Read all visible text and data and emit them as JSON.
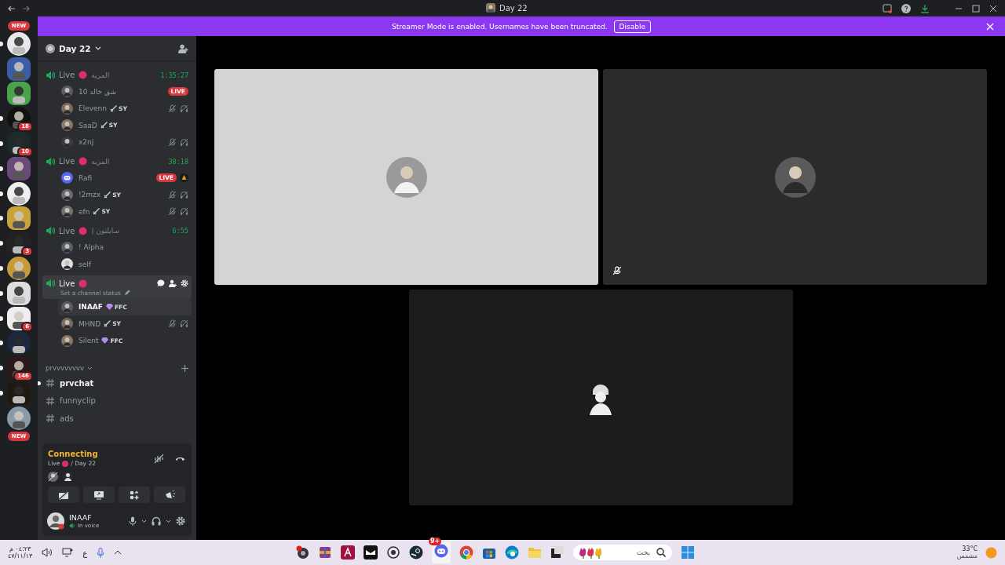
{
  "window": {
    "title": "Day 22"
  },
  "banner": {
    "text": "Streamer Mode is enabled. Usernames have been truncated.",
    "button": "Disable"
  },
  "servers": {
    "top_badge": "NEW",
    "bottom_badge": "NEW",
    "items": [
      {
        "unread": true
      },
      {
        "unread": false
      },
      {
        "unread": false
      },
      {
        "unread": true,
        "badge": "18"
      },
      {
        "unread": true,
        "badge": "10"
      },
      {
        "unread": true
      },
      {
        "unread": true
      },
      {
        "unread": true
      },
      {
        "unread": true,
        "badge": "3"
      },
      {
        "unread": true
      },
      {
        "unread": true
      },
      {
        "unread": true,
        "badge": "6"
      },
      {
        "unread": true
      },
      {
        "unread": true,
        "badge": "146"
      },
      {
        "unread": true
      },
      {
        "unread": false
      }
    ]
  },
  "guild": {
    "name": "Day 22"
  },
  "voice_channels": [
    {
      "name": "Live",
      "status": "المزيه",
      "timer": "1:35:27",
      "selected": false,
      "users": [
        {
          "name": "شق خالد 10",
          "badge": "LIVE",
          "muted": false
        },
        {
          "name": "Elevenn",
          "tag": {
            "kind": "sword",
            "text": "SY"
          },
          "muted": true
        },
        {
          "name": "SaaD",
          "tag": {
            "kind": "sword",
            "text": "SY"
          },
          "muted": false
        },
        {
          "name": "x2nj",
          "muted": true
        }
      ]
    },
    {
      "name": "Live",
      "status": "المزيه",
      "timer": "38:18",
      "selected": false,
      "users": [
        {
          "name": "Rafi",
          "badge": "LIVE",
          "muted": false,
          "activity": true
        },
        {
          "name": "!2mzx",
          "tag": {
            "kind": "sword",
            "text": "SY"
          },
          "muted": true
        },
        {
          "name": "efn",
          "tag": {
            "kind": "sword",
            "text": "SY"
          },
          "muted": true
        }
      ]
    },
    {
      "name": "Live",
      "status": "| سايلتون",
      "timer": "6:55",
      "selected": false,
      "users": [
        {
          "name": "! Alpha",
          "muted": false
        },
        {
          "name": "self",
          "muted": false
        }
      ]
    },
    {
      "name": "Live",
      "subtitle": "Set a channel status",
      "selected": true,
      "users": [
        {
          "name": "INAAF",
          "tag": {
            "kind": "gem",
            "text": "FFC"
          },
          "muted": false,
          "hovered": true
        },
        {
          "name": "MHND",
          "tag": {
            "kind": "sword",
            "text": "SY"
          },
          "muted": true
        },
        {
          "name": "Silent",
          "tag": {
            "kind": "gem",
            "text": "FFC"
          },
          "muted": false
        }
      ]
    }
  ],
  "category": {
    "name": "prvvvvvvvv"
  },
  "text_channels": [
    {
      "name": "prvchat",
      "unread": true
    },
    {
      "name": "funnyclip",
      "unread": false
    },
    {
      "name": "ads",
      "unread": false
    }
  ],
  "voice_panel": {
    "state": "Connecting",
    "channel": "Live",
    "server": "/ Day 22"
  },
  "user_panel": {
    "name": "INAAF",
    "status": "In voice"
  },
  "tiles": [
    {
      "muted": false
    },
    {
      "muted": true
    },
    {
      "muted": false
    }
  ],
  "taskbar": {
    "time": "٠٤:٢٣ م",
    "date": "٤٧/١١/١٣",
    "language": "ع",
    "search_placeholder": "بحث",
    "temperature": "33°C",
    "weather": "مشمس",
    "discord_badge": "9+"
  }
}
